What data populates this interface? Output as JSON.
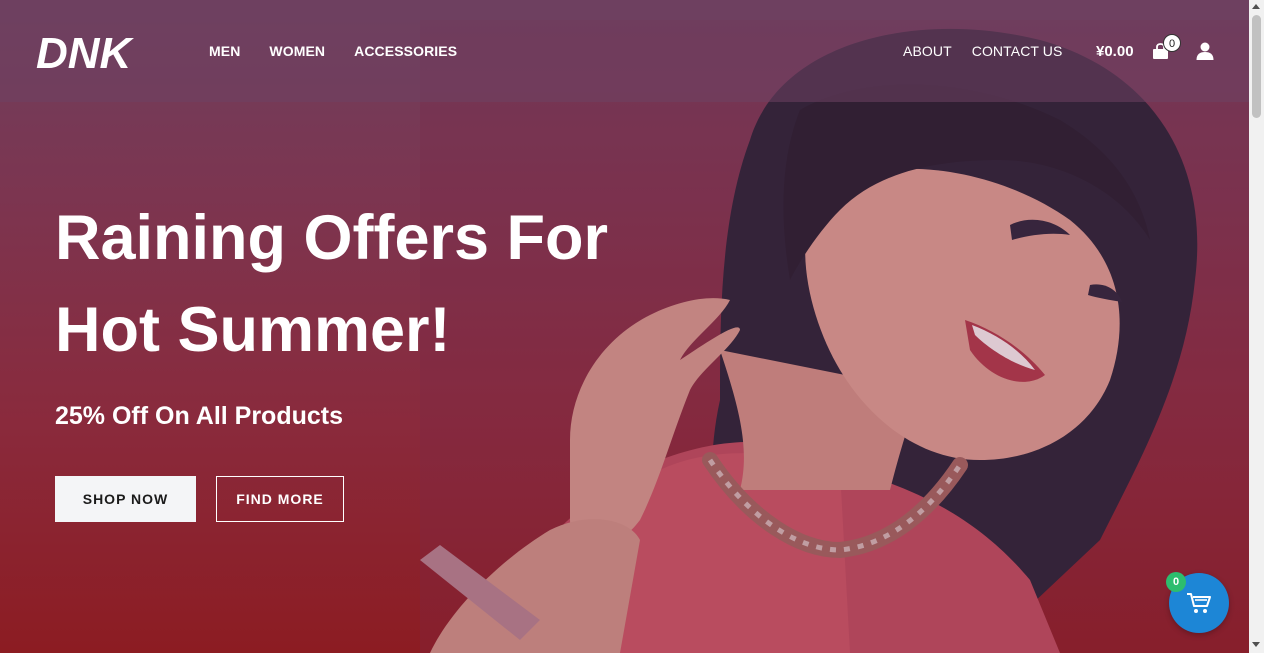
{
  "brand": {
    "logo_text": "DNK"
  },
  "nav": {
    "main": [
      "MEN",
      "WOMEN",
      "ACCESSORIES"
    ],
    "right": [
      "ABOUT",
      "CONTACT US"
    ]
  },
  "cart": {
    "total": "¥0.00",
    "count": "0"
  },
  "hero": {
    "headline_line1": "Raining Offers For",
    "headline_line2": "Hot Summer!",
    "subhead": "25% Off On All Products",
    "shop_now": "SHOP NOW",
    "find_more": "FIND MORE"
  },
  "floating_cart": {
    "count": "0"
  },
  "colors": {
    "accent": "#1d86d6",
    "badge": "#2dbd6e",
    "hero_top": "#6f3f5e",
    "hero_bottom": "#8c1c22"
  },
  "icons": {
    "bag": "shopping-bag-icon",
    "user": "user-icon",
    "cart": "cart-icon"
  }
}
